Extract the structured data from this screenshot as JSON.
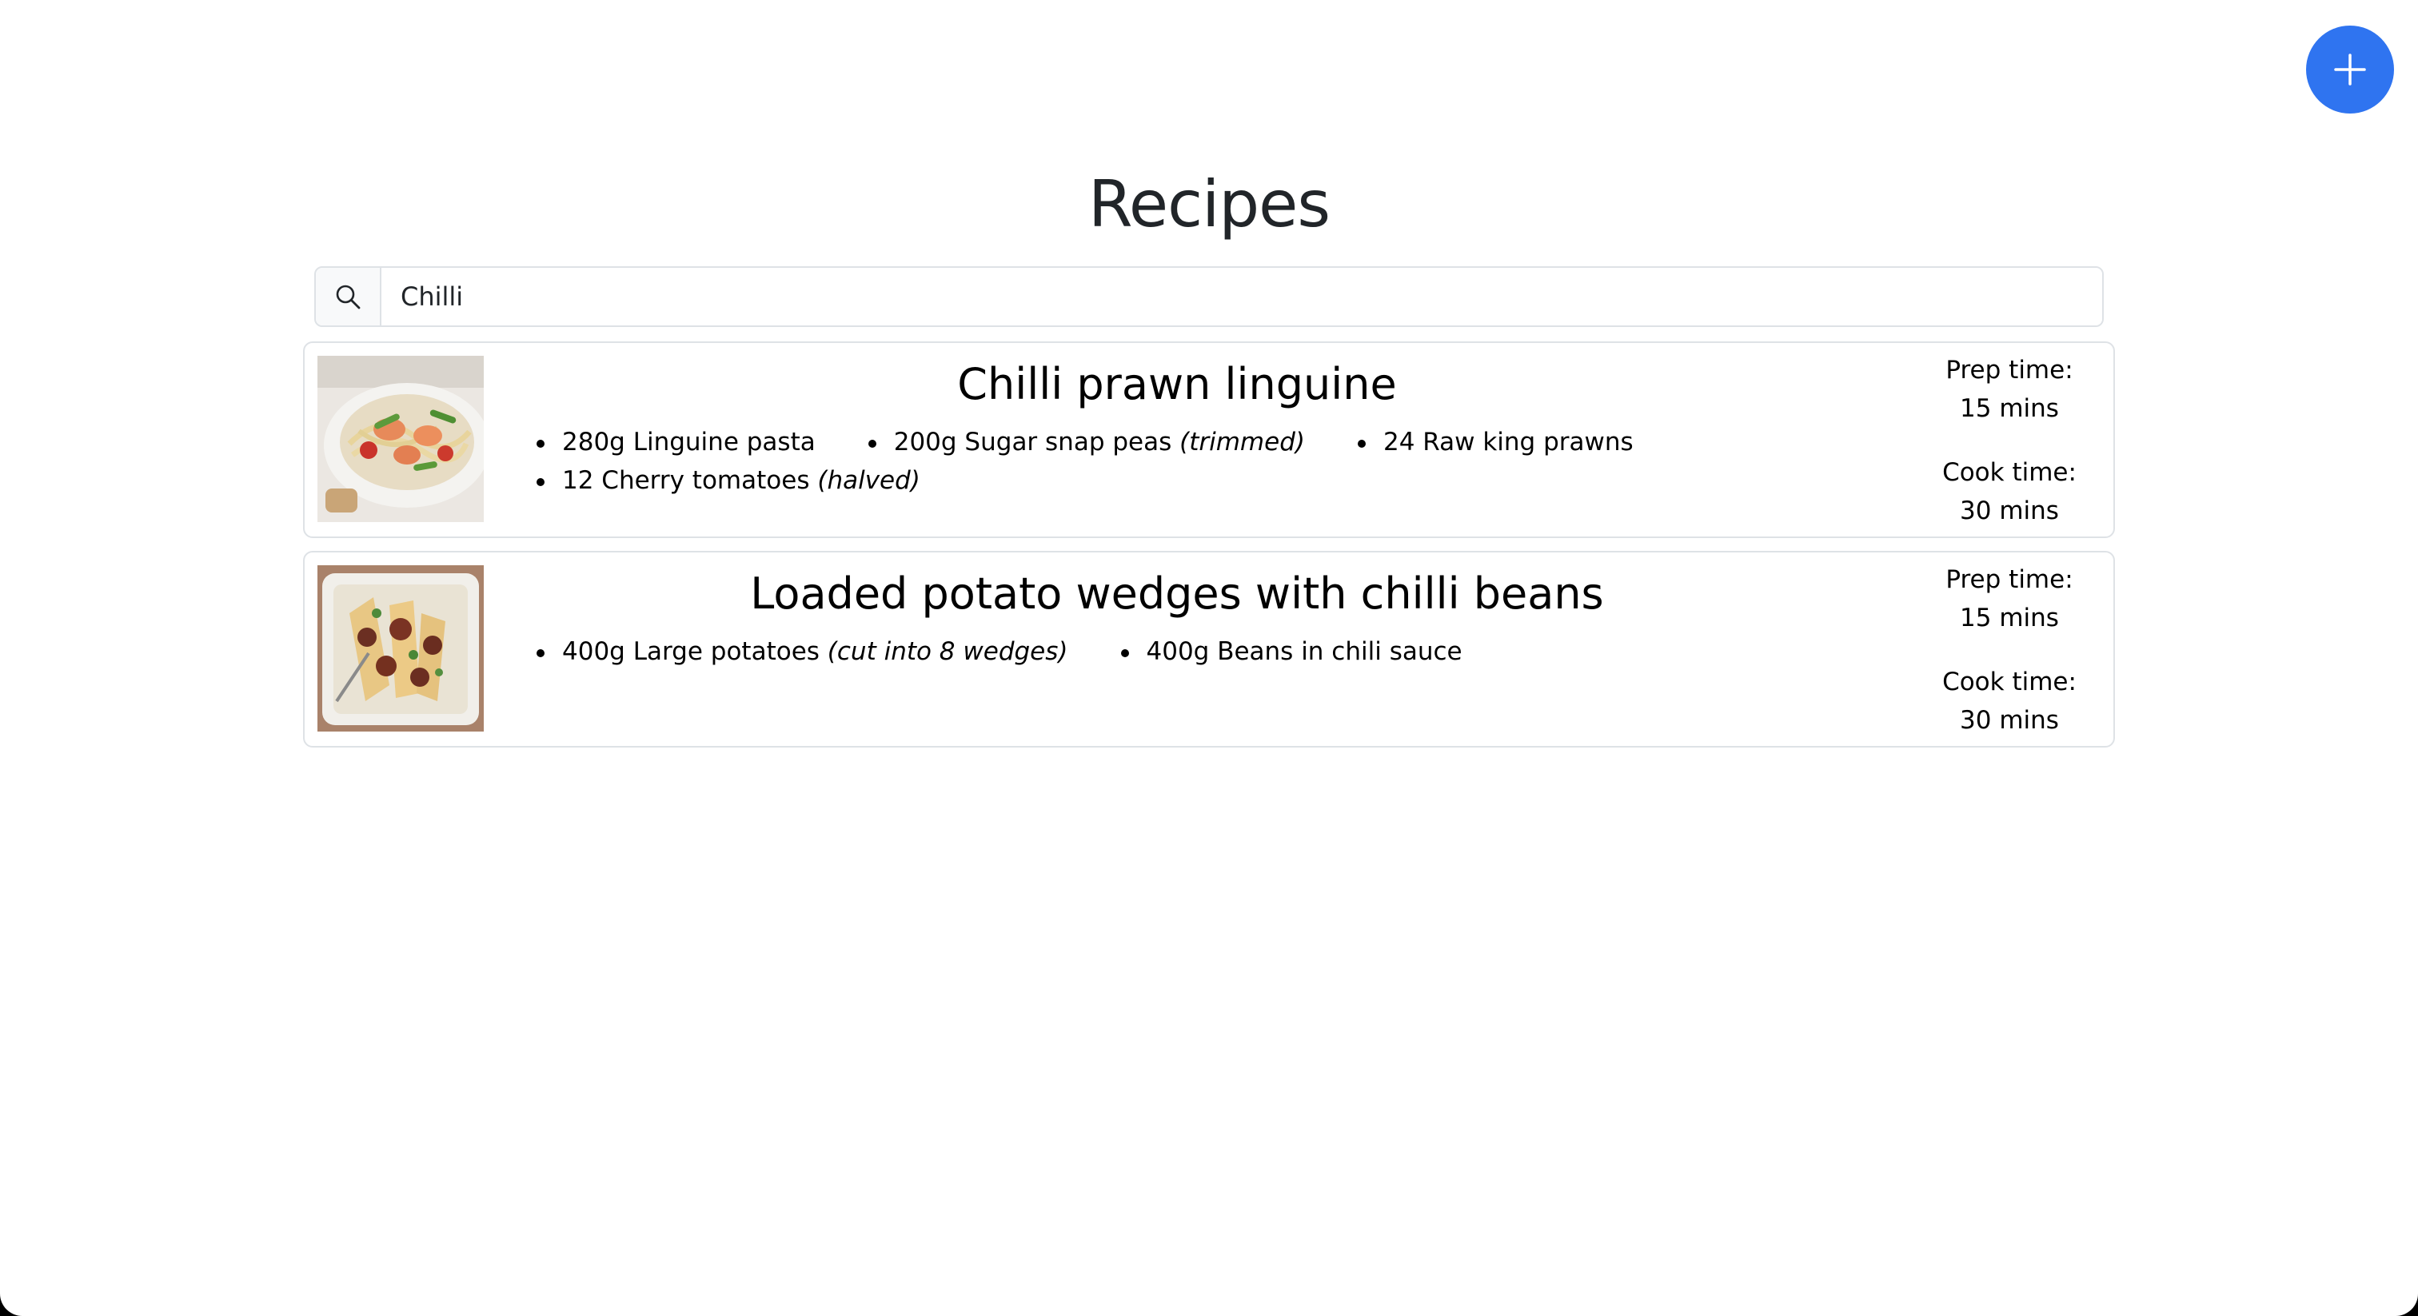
{
  "page": {
    "title": "Recipes"
  },
  "fab": {
    "icon": "plus-icon",
    "color": "#2f74f0"
  },
  "search": {
    "icon": "search-icon",
    "value": "Chilli"
  },
  "recipes": [
    {
      "name": "Chilli prawn linguine",
      "image": "pasta-dish-photo",
      "ingredients": [
        {
          "text": "280g Linguine pasta",
          "note": ""
        },
        {
          "text": "200g Sugar snap peas",
          "note": "(trimmed)"
        },
        {
          "text": "24 Raw king prawns",
          "note": ""
        },
        {
          "text": "12 Cherry tomatoes",
          "note": "(halved)"
        }
      ],
      "prep_label": "Prep time:",
      "prep_value": "15 mins",
      "cook_label": "Cook time:",
      "cook_value": "30 mins"
    },
    {
      "name": "Loaded potato wedges with chilli beans",
      "image": "potato-wedges-photo",
      "ingredients": [
        {
          "text": "400g Large potatoes",
          "note": "(cut into 8 wedges)"
        },
        {
          "text": "400g Beans in chili sauce",
          "note": ""
        }
      ],
      "prep_label": "Prep time:",
      "prep_value": "15 mins",
      "cook_label": "Cook time:",
      "cook_value": "30 mins"
    }
  ]
}
